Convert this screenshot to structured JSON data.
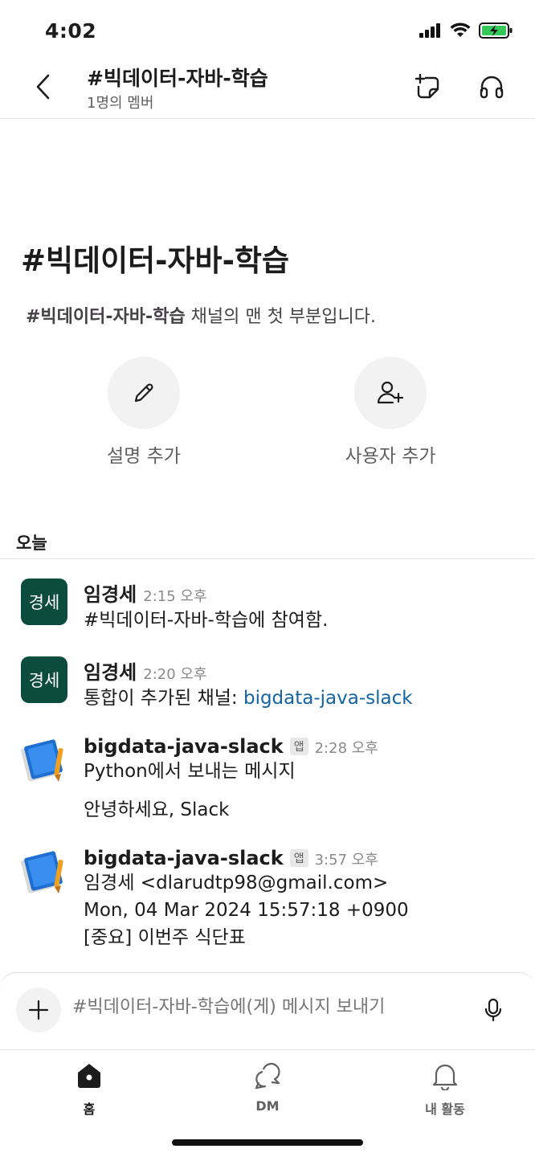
{
  "status_bar": {
    "time": "4:02"
  },
  "header": {
    "title": "#빅데이터-자바-학습",
    "subtitle": "1명의 멤버"
  },
  "intro": {
    "title": "#빅데이터-자바-학습",
    "desc_channel": "#빅데이터-자바-학습",
    "desc_rest": " 채널의 맨 첫 부분입니다."
  },
  "actions": {
    "add_description": "설명 추가",
    "add_people": "사용자 추가"
  },
  "day_divider": "오늘",
  "messages": [
    {
      "avatar_text": "경세",
      "author": "임경세",
      "time": "2:15 오후",
      "text": "#빅데이터-자바-학습에 참여함."
    },
    {
      "avatar_text": "경세",
      "author": "임경세",
      "time": "2:20 오후",
      "text_prefix": "통합이 추가된 채널: ",
      "link": "bigdata-java-slack"
    },
    {
      "author": "bigdata-java-slack",
      "badge": "앱",
      "time": "2:28 오후",
      "line1": "Python에서 보내는 메시지",
      "line2": "안녕하세요, Slack"
    },
    {
      "author": "bigdata-java-slack",
      "badge": "앱",
      "time": "3:57 오후",
      "line1": "임경세 <dlarudtp98@gmail.com>",
      "line2": "Mon, 04 Mar 2024 15:57:18 +0900",
      "line3": "[중요] 이번주 식단표"
    }
  ],
  "composer": {
    "placeholder": "#빅데이터-자바-학습에(게) 메시지 보내기"
  },
  "tabs": [
    {
      "label": "홈",
      "icon": "home-icon",
      "active": true
    },
    {
      "label": "DM",
      "icon": "dm-icon",
      "active": false
    },
    {
      "label": "내 활동",
      "icon": "bell-icon",
      "active": false
    }
  ],
  "colors": {
    "avatar_bg": "#0b4c3f",
    "link": "#1264a3",
    "battery": "#34c759"
  }
}
